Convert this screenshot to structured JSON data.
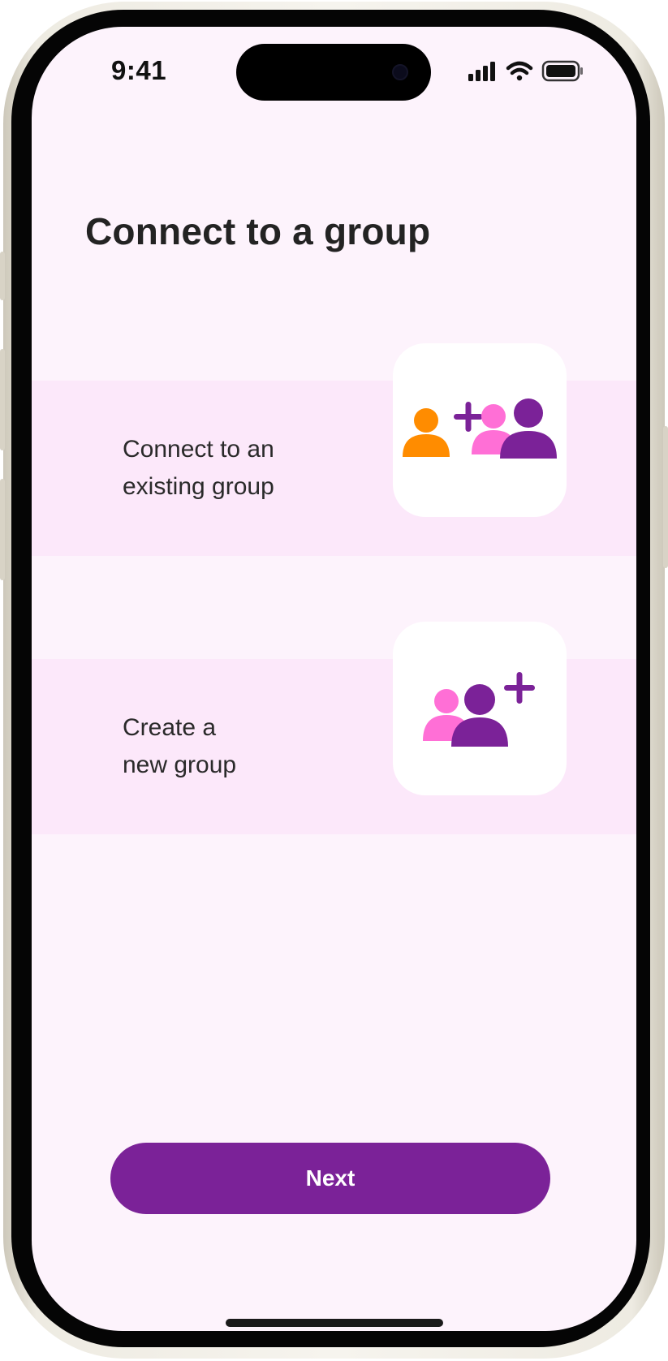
{
  "status_bar": {
    "time": "9:41",
    "signal_icon": "cellular-signal-icon",
    "wifi_icon": "wifi-icon",
    "battery_icon": "battery-icon"
  },
  "page": {
    "title": "Connect to a group"
  },
  "options": [
    {
      "label_line1": "Connect to an",
      "label_line2": "existing group",
      "icon": "join-group-icon"
    },
    {
      "label_line1": "Create a",
      "label_line2": "new group",
      "icon": "create-group-icon"
    }
  ],
  "footer": {
    "next_label": "Next"
  },
  "colors": {
    "background": "#fdf3fc",
    "option_band": "#fce8fa",
    "accent_purple": "#7b2298",
    "accent_pink": "#ff6fd6",
    "accent_orange": "#ff8c00"
  }
}
